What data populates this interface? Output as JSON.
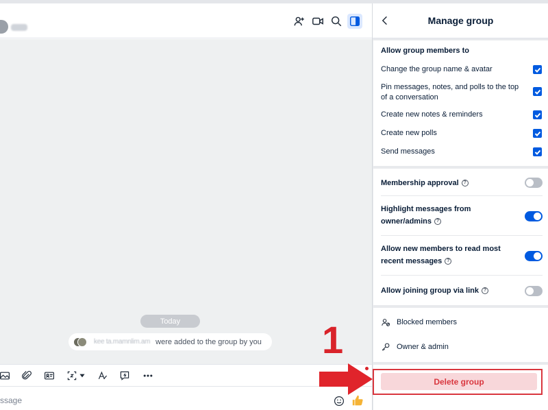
{
  "panel": {
    "title": "Manage group",
    "permissions_heading": "Allow group members to",
    "permissions": [
      {
        "label": "Change the group name & avatar",
        "checked": true
      },
      {
        "label": "Pin messages, notes, and polls to the top of a conversation",
        "checked": true
      },
      {
        "label": "Create new notes & reminders",
        "checked": true
      },
      {
        "label": "Create new polls",
        "checked": true
      },
      {
        "label": "Send messages",
        "checked": true
      }
    ],
    "toggles": [
      {
        "label": "Membership approval",
        "on": false
      },
      {
        "label": "Highlight messages from owner/admins",
        "on": true
      },
      {
        "label": "Allow new members to read most recent messages",
        "on": true
      },
      {
        "label": "Allow joining group via link",
        "on": false
      }
    ],
    "links": [
      {
        "label": "Blocked members",
        "icon": "blocked-members-icon"
      },
      {
        "label": "Owner & admin",
        "icon": "key-icon"
      }
    ],
    "delete_label": "Delete group"
  },
  "chat": {
    "date_label": "Today",
    "notice_text": "were added to the group by you",
    "notice_names": "kee ta.mamnlim.am",
    "input_placeholder": "ssage"
  },
  "annotation": {
    "step_number": "1"
  },
  "colors": {
    "accent": "#005ae0",
    "danger": "#d9363e",
    "danger_bg": "#f8d7da",
    "annotation_red": "#d9232a"
  }
}
